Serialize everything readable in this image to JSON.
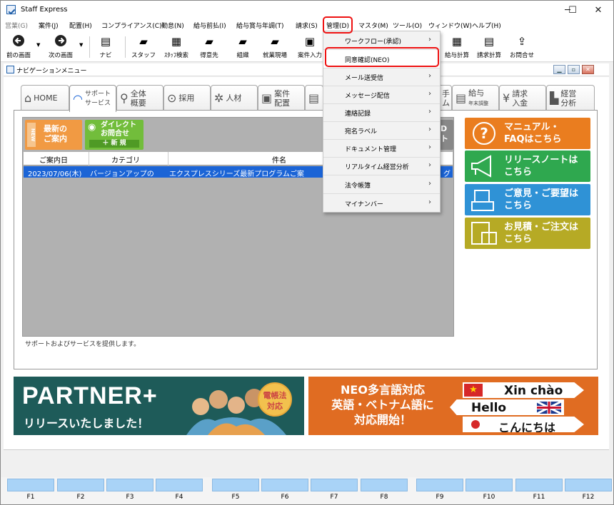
{
  "window": {
    "title": "Staff Express",
    "controls": {
      "minimize": "─",
      "maximize": "☐",
      "close": "✕"
    }
  },
  "menubar": {
    "items": [
      "営業(G)",
      "案件(J)",
      "配置(H)",
      "コンプライアンス(C)",
      "勤怠(N)",
      "給与前払(I)",
      "給与賞与年調(T)",
      "請求(S)",
      "管理(D)",
      "マスタ(M)",
      "ツール(O)",
      "ウィンドウ(W)",
      "ヘルプ(H)"
    ]
  },
  "toolbar": {
    "back": "前の画面",
    "forward": "次の画面",
    "navi": "ナビ",
    "staff": "スタッフ",
    "staff_search": "ｽﾀｯﾌ検索",
    "client": "得意先",
    "org": "組織",
    "site": "就業現場",
    "job_in": "案件入力",
    "payroll": "給与計算",
    "billing": "請求計算",
    "contact": "お問合せ"
  },
  "nav_window": {
    "title": "ナビゲーションメニュー"
  },
  "tabs": [
    {
      "l1": "HOME",
      "l2": ""
    },
    {
      "l1": "サポート",
      "l2": "サービス"
    },
    {
      "l1": "全体",
      "l2": "概要"
    },
    {
      "l1": "採用",
      "l2": ""
    },
    {
      "l1": "人材",
      "l2": ""
    },
    {
      "l1": "案件",
      "l2": "配置"
    },
    {
      "l1": "手",
      "l2": "ム"
    },
    {
      "l1": "給与",
      "l2": "年末調整"
    },
    {
      "l1": "請求",
      "l2": "入金"
    },
    {
      "l1": "経営",
      "l2": "分析"
    }
  ],
  "panel": {
    "new_button": {
      "badge": "NEW",
      "l1": "最新の",
      "l2": "ご案内"
    },
    "direct_button": {
      "l1": "ダイレクト",
      "l2": "お問合せ",
      "l3": "＋ 新 規"
    },
    "partial_button": {
      "l1": "D",
      "l2": "ト"
    },
    "grid": {
      "columns": [
        "ご案内日",
        "カテゴリ",
        "件名"
      ],
      "rows": [
        {
          "date": "2023/07/06(木)",
          "category": "バージョンアップの",
          "subject": "エクスプレスシリーズ最新プログラムご案",
          "tail": "グ"
        }
      ]
    },
    "status": "サポートおよびサービスを提供します。"
  },
  "side_buttons": [
    {
      "l1": "マニュアル・",
      "l2": "FAQはこちら",
      "color": "#ea7d1f"
    },
    {
      "l1": "リリースノートは",
      "l2": "こちら",
      "color": "#2fa84f"
    },
    {
      "l1": "ご意見・ご要望は",
      "l2": "こちら",
      "color": "#2f92d6"
    },
    {
      "l1": "お見積・ご注文は",
      "l2": "こちら",
      "color": "#b6aa25"
    }
  ],
  "banner1": {
    "title": "PARTNER+",
    "subtitle": "リリースいたしました！",
    "badge_l1": "電帳法",
    "badge_l2": "対応"
  },
  "banner2": {
    "l1": "NEO多言語対応",
    "l2": "英語・ベトナム語に",
    "l3": "対応開始！",
    "bubble1": "Xin chào",
    "bubble2": "Hello",
    "bubble3": "こんにちは"
  },
  "fkeys": [
    "F1",
    "F2",
    "F3",
    "F4",
    "F5",
    "F6",
    "F7",
    "F8",
    "F9",
    "F10",
    "F11",
    "F12"
  ],
  "dropdown": {
    "items": [
      {
        "label": "ワークフロー(承認)",
        "submenu": true
      },
      {
        "label": "同意確認(NEO)",
        "submenu": false
      },
      {
        "label": "メール送受信",
        "submenu": true
      },
      {
        "label": "メッセージ配信",
        "submenu": true
      },
      {
        "label": "連絡記録",
        "submenu": true
      },
      {
        "label": "宛名ラベル",
        "submenu": true
      },
      {
        "label": "ドキュメント管理",
        "submenu": true
      },
      {
        "label": "リアルタイム経営分析",
        "submenu": true
      },
      {
        "label": "法令帳簿",
        "submenu": true
      },
      {
        "label": "マイナンバー",
        "submenu": true
      }
    ],
    "arrow": "›"
  },
  "colors": {
    "accent": "#1b64d6",
    "highlight": "#e11111",
    "fkey": "#a9d3f7"
  }
}
